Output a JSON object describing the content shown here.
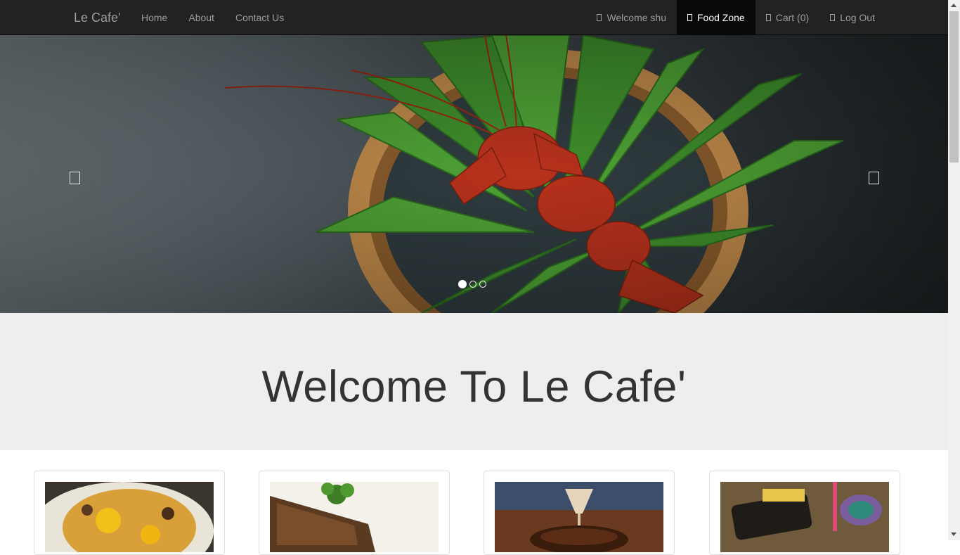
{
  "navbar": {
    "brand": "Le Cafe'",
    "left_items": [
      {
        "label": "Home"
      },
      {
        "label": "About"
      },
      {
        "label": "Contact Us"
      }
    ],
    "right_items": [
      {
        "label": "Welcome shu",
        "icon": "user-icon"
      },
      {
        "label": "Food Zone",
        "icon": "cutlery-icon",
        "active": true
      },
      {
        "label": "Cart (0)",
        "icon": "cart-icon"
      },
      {
        "label": "Log Out",
        "icon": "logout-icon"
      }
    ]
  },
  "carousel": {
    "slide_count": 3,
    "active_slide": 1,
    "image": "lobster-on-bamboo-leaves-image",
    "prev_icon": "chevron-left-icon",
    "next_icon": "chevron-right-icon"
  },
  "jumbotron": {
    "title": "Welcome To Le Cafe'"
  },
  "products": [
    {
      "image": "egg-dish-image"
    },
    {
      "image": "grilled-fish-image"
    },
    {
      "image": "dessert-drink-image"
    },
    {
      "image": "birthday-cake-image"
    }
  ],
  "colors": {
    "navbar_bg": "#222222",
    "navbar_text": "#9d9d9d",
    "active_bg": "#080808",
    "jumbotron_bg": "#eeeeee"
  }
}
